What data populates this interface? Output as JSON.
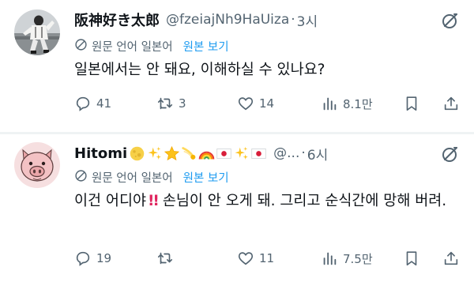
{
  "tweets": [
    {
      "display_name": "阪神好き太郎",
      "handle": "@fzeiajNh9HaUiza",
      "separator": "·",
      "time": "3시",
      "translation_note": "원문 언어 일본어",
      "show_original": "원본 보기",
      "body": "일본에서는 안 돼요, 이해하실 수 있나요?",
      "replies": "41",
      "reposts": "3",
      "likes": "14",
      "views": "8.1만",
      "icons": [
        "grok-icon",
        "translate-icon",
        "reply-icon",
        "repost-icon",
        "like-icon",
        "views-icon",
        "bookmark-icon",
        "share-icon"
      ]
    },
    {
      "display_name": "Hitomi",
      "name_emojis": [
        "full-moon",
        "sparkles",
        "star",
        "comet",
        "rainbow",
        "japan-flag",
        "sparkles",
        "japan-flag"
      ],
      "handle": "@...",
      "separator": "·",
      "time": "6시",
      "translation_note": "원문 언어 일본어",
      "show_original": "원본 보기",
      "body_part1": "이건 어디야",
      "body_bang": "!!",
      "body_part2": "손님이 안 오게 돼. 그리고 순식간에 망해 버려.",
      "replies": "19",
      "reposts": "",
      "likes": "11",
      "views": "7.5만"
    }
  ],
  "colors": {
    "text": "#0f1419",
    "secondary": "#536471",
    "link": "#1d9bf0",
    "divider": "#eff3f4",
    "exclaim": "#e0245e"
  }
}
